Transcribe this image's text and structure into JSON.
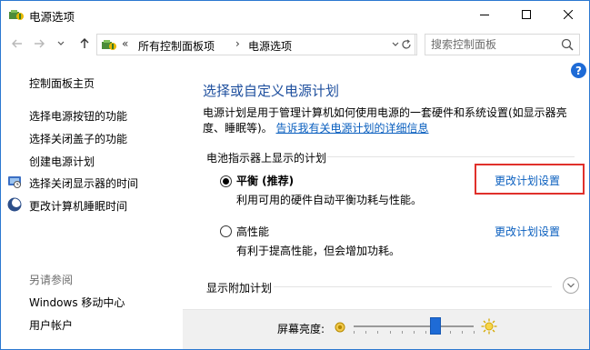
{
  "window": {
    "title": "电源选项",
    "controls": {
      "minimize": "minimize",
      "maximize": "maximize",
      "close": "close"
    }
  },
  "addressbar": {
    "overflow": "«",
    "crumbs": [
      "所有控制面板项",
      "电源选项"
    ],
    "separator": "›",
    "search_placeholder": "搜索控制面板"
  },
  "help": {
    "label": "?"
  },
  "sidebar": {
    "home": "控制面板主页",
    "links": [
      "选择电源按钮的功能",
      "选择关闭盖子的功能",
      "创建电源计划",
      "选择关闭显示器的时间",
      "更改计算机睡眠时间"
    ],
    "see_also_title": "另请参阅",
    "see_also": [
      "Windows 移动中心",
      "用户帐户"
    ]
  },
  "main": {
    "heading": "选择或自定义电源计划",
    "description": "电源计划是用于管理计算机如何使用电源的一套硬件和系统设置(如显示器亮度、睡眠等)。",
    "description_link": "告诉我有关电源计划的详细信息",
    "group_title": "电池指示器上显示的计划",
    "plans": [
      {
        "name": "平衡 (推荐)",
        "desc": "利用可用的硬件自动平衡功耗与性能。",
        "link": "更改计划设置",
        "selected": true
      },
      {
        "name": "高性能",
        "desc": "有利于提高性能，但会增加功耗。",
        "link": "更改计划设置",
        "selected": false
      }
    ],
    "extra_plans": "显示附加计划"
  },
  "brightness": {
    "label": "屏幕亮度:",
    "level_fraction": 0.68
  },
  "colors": {
    "accent": "#1e6bd6",
    "link": "#0a5fbf",
    "heading": "#1e4f9e",
    "highlight_box": "#e0302b"
  }
}
